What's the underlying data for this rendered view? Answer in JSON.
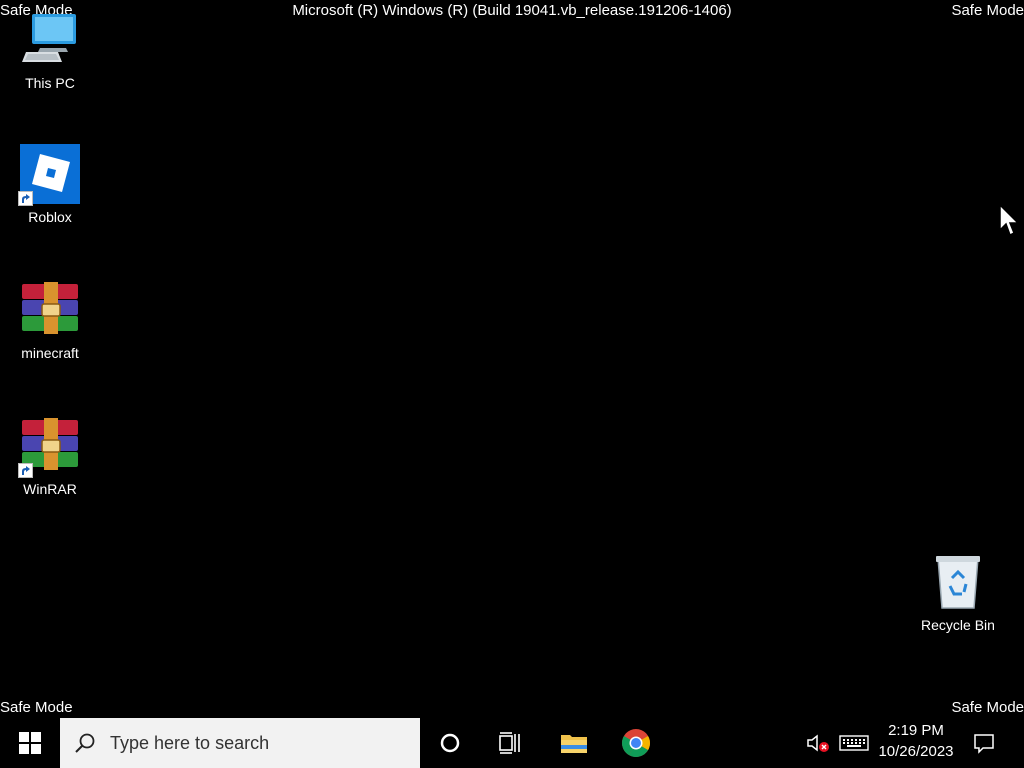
{
  "overlay": {
    "safe_mode_top_left": "Safe Mode",
    "safe_mode_top_right": "Safe Mode",
    "safe_mode_bottom_left": "Safe Mode",
    "safe_mode_bottom_right": "Safe Mode",
    "build_text": "Microsoft (R) Windows (R) (Build 19041.vb_release.191206-1406)"
  },
  "desktop": {
    "icons": [
      {
        "label": "This PC",
        "icon": "this-pc-icon"
      },
      {
        "label": "Roblox",
        "icon": "roblox-icon",
        "shortcut": true
      },
      {
        "label": "minecraft",
        "icon": "winrar-archive-icon"
      },
      {
        "label": "WinRAR",
        "icon": "winrar-icon",
        "shortcut": true
      },
      {
        "label": "Recycle Bin",
        "icon": "recycle-bin-icon"
      }
    ]
  },
  "taskbar": {
    "search_placeholder": "Type here to search",
    "pinned": [
      "cortana-icon",
      "task-view-icon",
      "file-explorer-icon",
      "chrome-icon"
    ],
    "tray": {
      "volume_state": "muted",
      "time": "2:19 PM",
      "date": "10/26/2023"
    }
  },
  "colors": {
    "desktop_background": "#000000",
    "search_box": "#f2f2f2",
    "roblox_tile": "#0a6fd6"
  }
}
